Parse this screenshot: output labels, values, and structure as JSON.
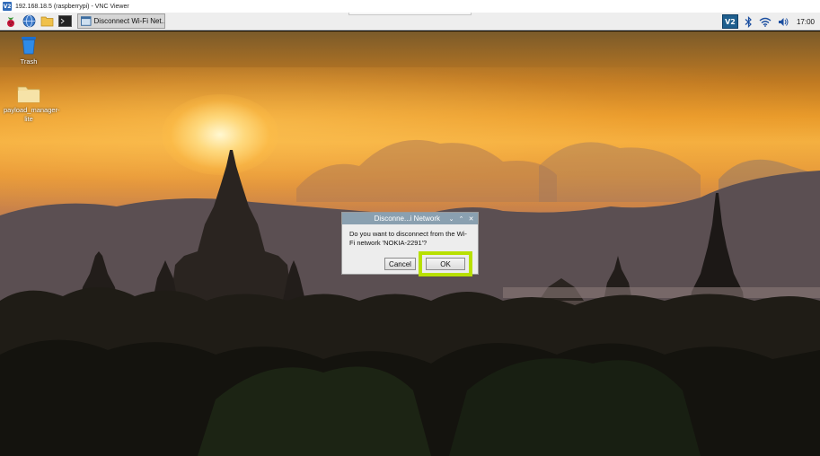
{
  "window": {
    "title": "192.168.18.5 (raspberrypi) - VNC Viewer",
    "logo_text": "V2"
  },
  "taskbar": {
    "icons": [
      "raspberry-menu-icon",
      "web-browser-icon",
      "file-manager-icon",
      "terminal-icon"
    ],
    "task_button_label": "Disconnect Wi-Fi Net...",
    "tray": [
      "vnc-icon",
      "bluetooth-icon",
      "wifi-icon",
      "volume-icon"
    ],
    "vnc_tray_text": "V2",
    "clock": "17:00"
  },
  "desktop": {
    "icons": [
      {
        "label": "Trash",
        "icon": "trash-icon"
      },
      {
        "label": "payload_manager-lite",
        "icon": "folder-icon"
      }
    ]
  },
  "dialog": {
    "title": "Disconne...i Network",
    "controls": {
      "minimize": "⌄",
      "maximize": "⌃",
      "close": "✕"
    },
    "message": "Do you want to disconnect from the Wi-Fi network 'NOKIA-2291'?",
    "cancel_label": "Cancel",
    "ok_label": "OK",
    "highlight_color": "#b8e000"
  }
}
